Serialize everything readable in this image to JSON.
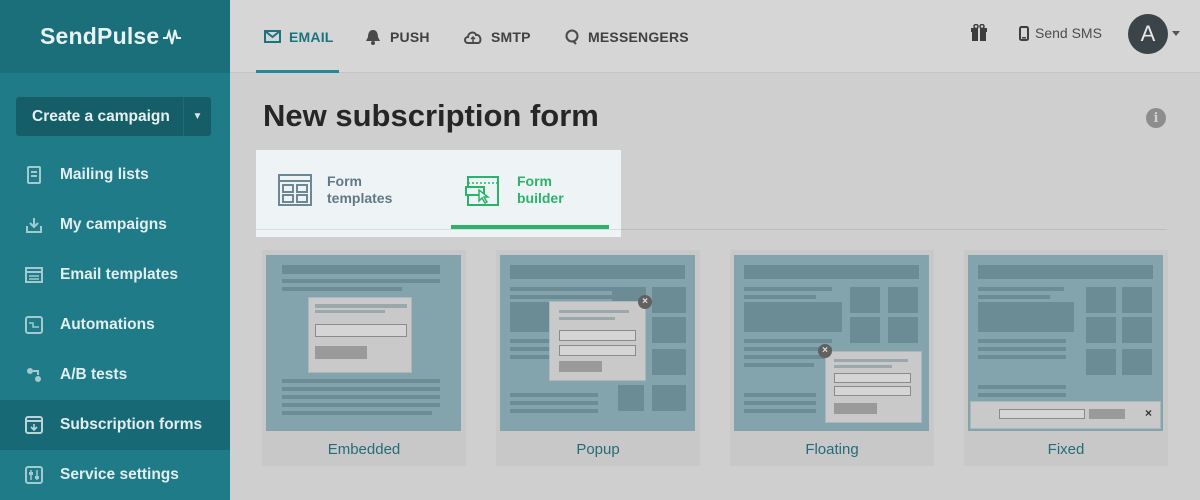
{
  "brand": {
    "name": "SendPulse"
  },
  "sidebar": {
    "create_label": "Create a campaign",
    "items": [
      {
        "label": "Mailing lists",
        "icon": "list-icon"
      },
      {
        "label": "My campaigns",
        "icon": "campaigns-icon"
      },
      {
        "label": "Email templates",
        "icon": "templates-icon"
      },
      {
        "label": "Automations",
        "icon": "automation-icon"
      },
      {
        "label": "A/B tests",
        "icon": "ab-test-icon"
      },
      {
        "label": "Subscription forms",
        "icon": "form-icon",
        "active": true
      },
      {
        "label": "Service settings",
        "icon": "settings-icon"
      }
    ]
  },
  "topbar": {
    "tabs": [
      {
        "label": "EMAIL",
        "icon": "envelope-icon",
        "active": true
      },
      {
        "label": "PUSH",
        "icon": "bell-icon"
      },
      {
        "label": "SMTP",
        "icon": "cloud-icon"
      },
      {
        "label": "MESSENGERS",
        "icon": "chat-icon"
      }
    ],
    "send_sms": "Send SMS",
    "avatar_initial": "A"
  },
  "main": {
    "title": "New subscription form",
    "form_tabs": [
      {
        "label": "Form\ntemplates",
        "icon": "form-templates-icon"
      },
      {
        "label": "Form\nbuilder",
        "icon": "form-builder-icon",
        "active": true
      }
    ],
    "cards": [
      {
        "label": "Embedded"
      },
      {
        "label": "Popup"
      },
      {
        "label": "Floating"
      },
      {
        "label": "Fixed"
      }
    ]
  },
  "colors": {
    "accent": "#1f8b98",
    "sidebar": "#1e7b87",
    "green": "#2bb36b"
  }
}
